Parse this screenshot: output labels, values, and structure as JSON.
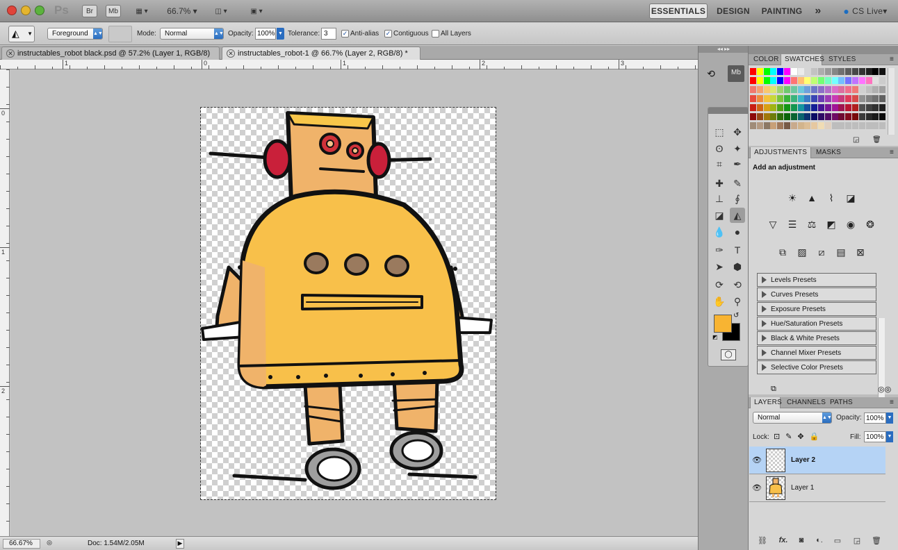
{
  "app": {
    "logo": "Ps",
    "launch_buttons": [
      "Br",
      "Mb"
    ],
    "zoom": "66.7%",
    "workspaces": [
      "ESSENTIALS",
      "DESIGN",
      "PAINTING"
    ],
    "more": "»",
    "cslive": "CS Live"
  },
  "options": {
    "fill_source": "Foreground",
    "mode_label": "Mode:",
    "mode": "Normal",
    "opacity_label": "Opacity:",
    "opacity": "100%",
    "tolerance_label": "Tolerance:",
    "tolerance": "3",
    "antialias": "Anti-alias",
    "contiguous": "Contiguous",
    "all_layers": "All Layers"
  },
  "tabs": [
    {
      "title": "instructables_robot black.psd @ 57.2% (Layer 1, RGB/8)"
    },
    {
      "title": "instructables_robot-1 @ 66.7% (Layer 2, RGB/8) *"
    }
  ],
  "ruler": {
    "h": [
      "1",
      "0",
      "1",
      "2",
      "3"
    ],
    "v": [
      "0",
      "1",
      "2"
    ]
  },
  "status": {
    "zoom": "66.67%",
    "doc": "Doc: 1.54M/2.05M"
  },
  "panels": {
    "color_tabs": [
      "COLOR",
      "SWATCHES",
      "STYLES"
    ],
    "adj_tabs": [
      "ADJUSTMENTS",
      "MASKS"
    ],
    "adj_title": "Add an adjustment",
    "presets": [
      "Levels Presets",
      "Curves Presets",
      "Exposure Presets",
      "Hue/Saturation Presets",
      "Black & White Presets",
      "Channel Mixer Presets",
      "Selective Color Presets"
    ],
    "layer_tabs": [
      "LAYERS",
      "CHANNELS",
      "PATHS"
    ],
    "blend": "Normal",
    "opacity_label": "Opacity:",
    "opacity": "100%",
    "lock_label": "Lock:",
    "fill_label": "Fill:",
    "fill": "100%",
    "layers": [
      {
        "name": "Layer 2"
      },
      {
        "name": "Layer 1"
      }
    ]
  },
  "colors": {
    "foreground": "#f8b432",
    "background": "#000000",
    "selected_layer": "#b5d3f5"
  }
}
